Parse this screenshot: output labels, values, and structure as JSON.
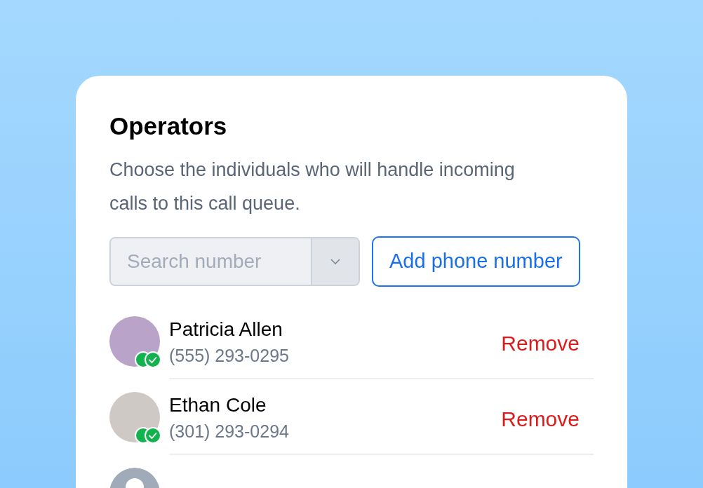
{
  "card": {
    "title": "Operators",
    "description": "Choose the individuals who will handle incoming calls to this call queue."
  },
  "search": {
    "placeholder": "Search number"
  },
  "add_button": "Add phone number",
  "operators": [
    {
      "kind": "photo",
      "name": "Patricia Allen",
      "phone": "(555) 293-0295",
      "verified": true,
      "action": "Remove"
    },
    {
      "kind": "photo",
      "name": "Ethan Cole",
      "phone": "(301) 293-0294",
      "verified": true,
      "action": "Remove"
    },
    {
      "kind": "generic"
    }
  ]
}
